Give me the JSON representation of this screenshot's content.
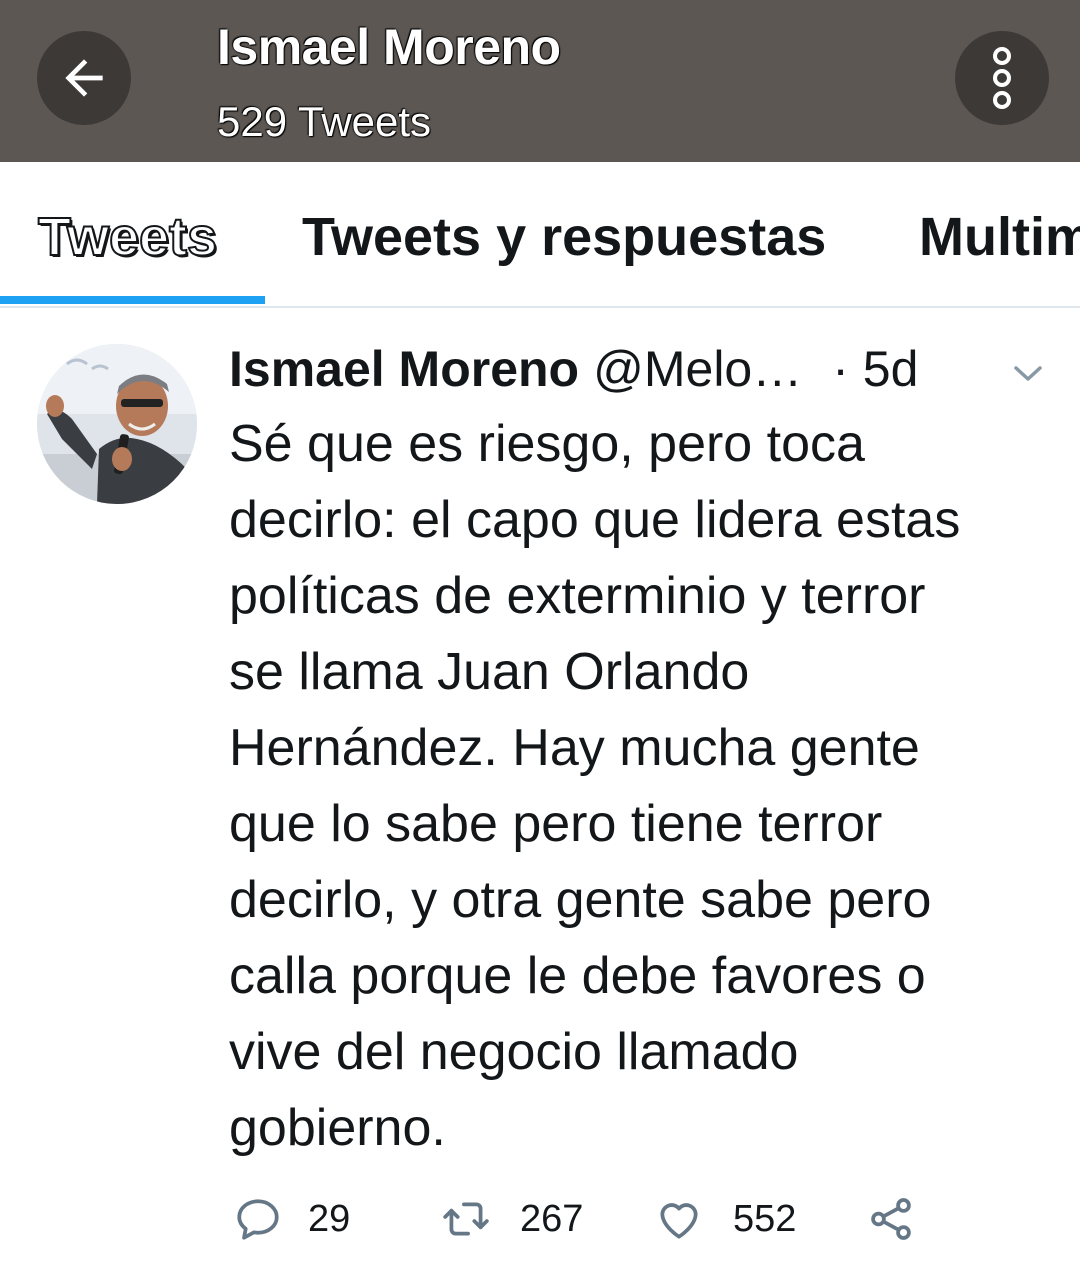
{
  "header": {
    "title": "Ismael Moreno",
    "subtitle": "529 Tweets",
    "back_icon": "arrow-left-icon",
    "more_icon": "more-vertical-icon"
  },
  "tabs": [
    {
      "label": "Tweets",
      "active": true
    },
    {
      "label": "Tweets y respuestas",
      "active": false
    },
    {
      "label": "Multim",
      "active": false
    }
  ],
  "tweet": {
    "author_name": "Ismael Moreno",
    "handle": "@Melo…",
    "time": "· 5d",
    "text": "Sé que es riesgo, pero toca\ndecirlo: el capo que lidera estas\npolíticas de exterminio y terror\nse llama Juan Orlando\nHernández. Hay mucha gente\nque lo sabe pero tiene terror\ndecirlo, y otra gente sabe pero\ncalla porque le debe favores o\nvive del negocio llamado\ngobierno.",
    "replies": "29",
    "retweets": "267",
    "likes": "552"
  },
  "colors": {
    "header_bg": "#5c5753",
    "button_bg": "#3d3937",
    "accent": "#1da1f2",
    "icon_gray": "#657786"
  }
}
